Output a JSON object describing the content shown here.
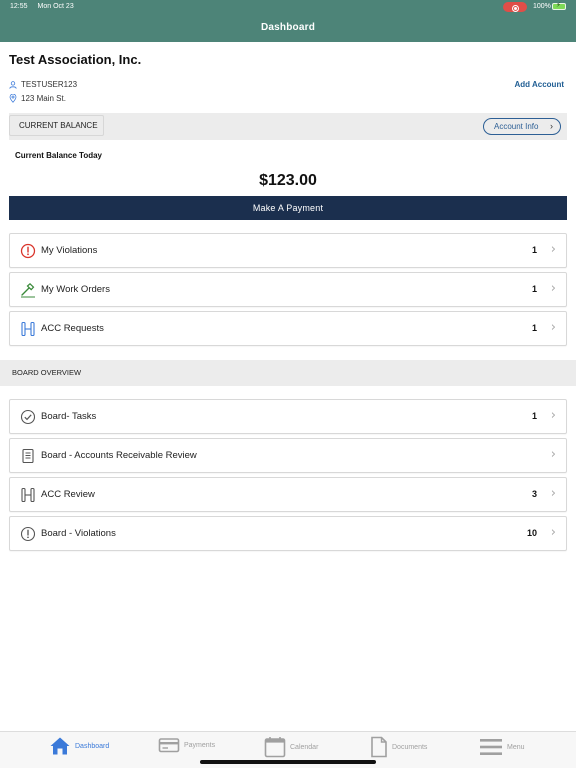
{
  "status": {
    "time": "12:55",
    "date": "Mon Oct 23",
    "battery": "100%",
    "colors": {
      "bar": "#4d8478",
      "record": "#e04e48",
      "battery": "#7ed957"
    }
  },
  "nav": {
    "title": "Dashboard"
  },
  "account": {
    "name": "Test Association, Inc.",
    "username": "TESTUSER123",
    "address": "123 Main St.",
    "add_account_label": "Add Account"
  },
  "balance": {
    "tab_label": "CURRENT BALANCE",
    "account_info_label": "Account Info",
    "today_label": "Current Balance Today",
    "amount": "$123.00",
    "pay_label": "Make A Payment",
    "colors": {
      "pay_button": "#1b2f4e",
      "link": "#1f5d93"
    }
  },
  "my_items": [
    {
      "label": "My Violations",
      "count": "1",
      "icon": "alert-circle-icon",
      "icon_color": "#d9342b"
    },
    {
      "label": "My Work Orders",
      "count": "1",
      "icon": "hammer-icon",
      "icon_color": "#3a8a3a"
    },
    {
      "label": "ACC Requests",
      "count": "1",
      "icon": "acc-request-icon",
      "icon_color": "#3b7ad9"
    }
  ],
  "board": {
    "header": "BOARD OVERVIEW",
    "items": [
      {
        "label": "Board- Tasks",
        "count": "1",
        "icon": "check-circle-icon"
      },
      {
        "label": "Board - Accounts Receivable Review",
        "count": "",
        "icon": "ledger-icon"
      },
      {
        "label": "ACC Review",
        "count": "3",
        "icon": "acc-review-icon"
      },
      {
        "label": "Board - Violations",
        "count": "10",
        "icon": "alert-circle-icon"
      }
    ]
  },
  "tabs": [
    {
      "label": "Dashboard",
      "icon": "home-icon",
      "active": true
    },
    {
      "label": "Payments",
      "icon": "credit-card-icon",
      "active": false
    },
    {
      "label": "Calendar",
      "icon": "calendar-icon",
      "active": false
    },
    {
      "label": "Documents",
      "icon": "document-icon",
      "active": false
    },
    {
      "label": "Menu",
      "icon": "menu-icon",
      "active": false
    }
  ]
}
